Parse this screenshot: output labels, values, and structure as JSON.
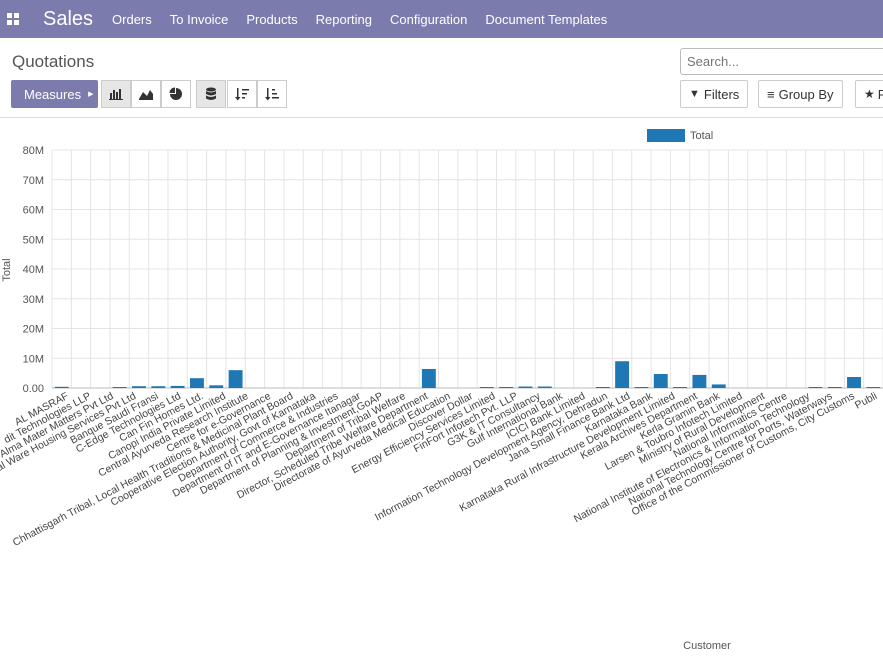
{
  "nav": {
    "brand": "Sales",
    "menu": [
      "Orders",
      "To Invoice",
      "Products",
      "Reporting",
      "Configuration",
      "Document Templates"
    ]
  },
  "page": {
    "title": "Quotations",
    "search_placeholder": "Search...",
    "measures_label": "Measures",
    "filters_label": "Filters",
    "groupby_label": "Group By",
    "favorites_label": "F"
  },
  "colors": {
    "nav_bg": "#7c7bad",
    "bar": "#1f77b4"
  },
  "chart_data": {
    "type": "bar",
    "ylabel": "Total",
    "xlabel": "Customer",
    "legend": [
      "Total"
    ],
    "legend_position": "top",
    "y_ticks": [
      "0.00",
      "10M",
      "20M",
      "30M",
      "40M",
      "50M",
      "60M",
      "70M",
      "80M"
    ],
    "ylim": [
      0,
      80000000
    ],
    "grid": true,
    "categories": [
      "AL MASRAF",
      "dit Technologies LLP",
      "Alma Mater Matters Pvt Ltd",
      "al Ware Housing Services Pvt Ltd",
      "Banque Saudi Fransi",
      "C-Edge Technologies Ltd",
      "Can Fin Homes Ltd.",
      "Canopi India Private Limited",
      "Central Ayurveda Research Institute",
      "Centre for e-Governance",
      "Chhattisgarh Tribal, Local Health Traditions & Medicinal Plant Board",
      "Cooperative Election Authority, Govt of Karnataka",
      "Department of Commerce & Industries",
      "Department of IT and E-Governance Itanagar",
      "Department of Planning & Investment,GoAP",
      "Department of Tribal Welfare",
      "Director, Scheduled Tribe Welfare Department",
      "Directorate of Ayurveda Medical Education",
      "Discover Dollar",
      "Energy Efficiency Services Limited",
      "FinFort Infotech Pvt. LLP",
      "G3K & IT Consultancy",
      "Gulf International Bank",
      "ICICI Bank Limited",
      "Information Technology Development Agency, Dehradun",
      "Jana Small Finance Bank Ltd",
      "Karnataka Bank",
      "Karnataka Rural Infrastructure Development Limited",
      "Kerala Archives Department",
      "Kerla Gramin Bank",
      "Larsen & Toubro Infotech Limited",
      "Ministry of Rural Development",
      "National Informatics Centre",
      "National Institute of Electronics & Information Technology",
      "National Technology Centre for Ports, Waterways",
      "Office of the Commissioner of Customs, City Customs",
      "Publi"
    ],
    "series": [
      {
        "name": "Total",
        "values": [
          400000,
          0,
          0,
          100000,
          600000,
          600000,
          700000,
          3300000,
          900000,
          6000000,
          0,
          0,
          0,
          0,
          0,
          0,
          0,
          0,
          0,
          6400000,
          0,
          0,
          100000,
          200000,
          500000,
          500000,
          0,
          0,
          100000,
          9000000,
          100000,
          4700000,
          300000,
          4400000,
          1200000,
          0,
          0,
          0,
          0,
          100000,
          300000,
          3700000,
          100000
        ]
      }
    ]
  }
}
